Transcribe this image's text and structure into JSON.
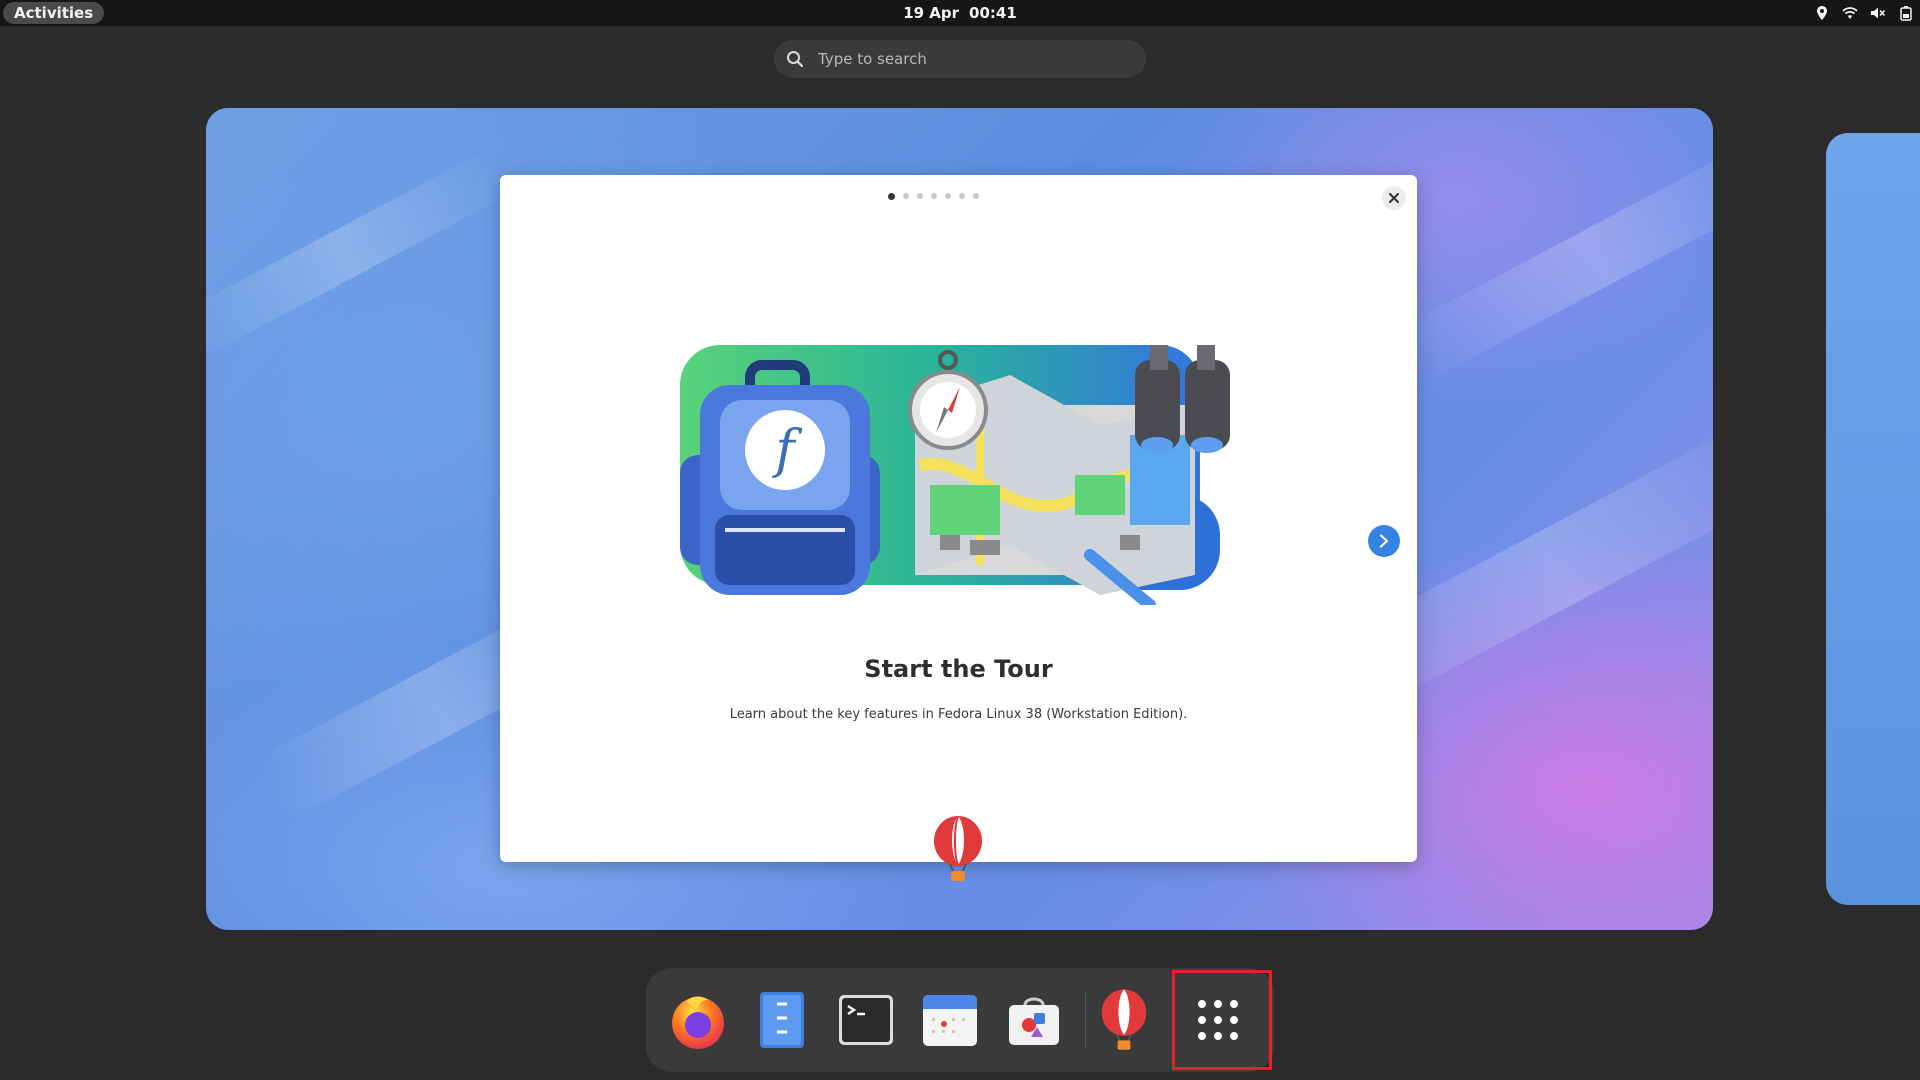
{
  "topbar": {
    "activities_label": "Activities",
    "date": "19 Apr",
    "time": "00:41",
    "tray_icons": [
      "location-icon",
      "wifi-icon",
      "volume-muted-icon",
      "battery-icon"
    ]
  },
  "search": {
    "placeholder": "Type to search"
  },
  "tour": {
    "page_count": 7,
    "current_page": 1,
    "title": "Start the Tour",
    "description": "Learn about the key features in Fedora Linux 38 (Workstation Edition).",
    "close_icon": "close-icon",
    "next_icon": "chevron-right-icon"
  },
  "dash": {
    "items": [
      {
        "name": "firefox",
        "icon": "firefox-icon"
      },
      {
        "name": "text-editor",
        "icon": "text-editor-icon"
      },
      {
        "name": "terminal",
        "icon": "terminal-icon"
      },
      {
        "name": "calendar",
        "icon": "calendar-icon"
      },
      {
        "name": "software",
        "icon": "software-icon"
      },
      {
        "name": "tour",
        "icon": "hot-air-balloon-icon"
      },
      {
        "name": "show-apps",
        "icon": "app-grid-icon"
      }
    ]
  },
  "colors": {
    "accent": "#3584e4",
    "topbar": "#161616",
    "highlight": "#e8202a"
  }
}
